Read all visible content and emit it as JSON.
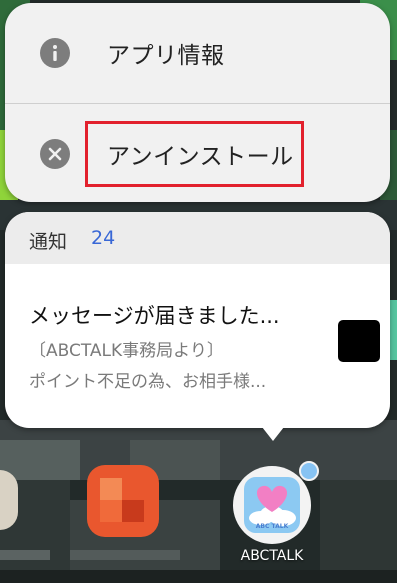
{
  "menu": {
    "app_info": {
      "label": "アプリ情報",
      "icon": "info-icon"
    },
    "uninstall": {
      "label": "アンインストール",
      "icon": "close-circle-icon"
    }
  },
  "notifications": {
    "title": "通知",
    "count": "24",
    "message": "メッセージが届きました...",
    "sender": "〔ABCTALK事務局より〕",
    "preview": "ポイント不足の為、お相手様..."
  },
  "app": {
    "label": "ABCTALK",
    "icon_text": "ABC TALK",
    "icon": "heart-cloud-icon"
  },
  "colors": {
    "highlight": "#e2212d",
    "accent": "#3867d6",
    "badge": "#87c3f3"
  }
}
